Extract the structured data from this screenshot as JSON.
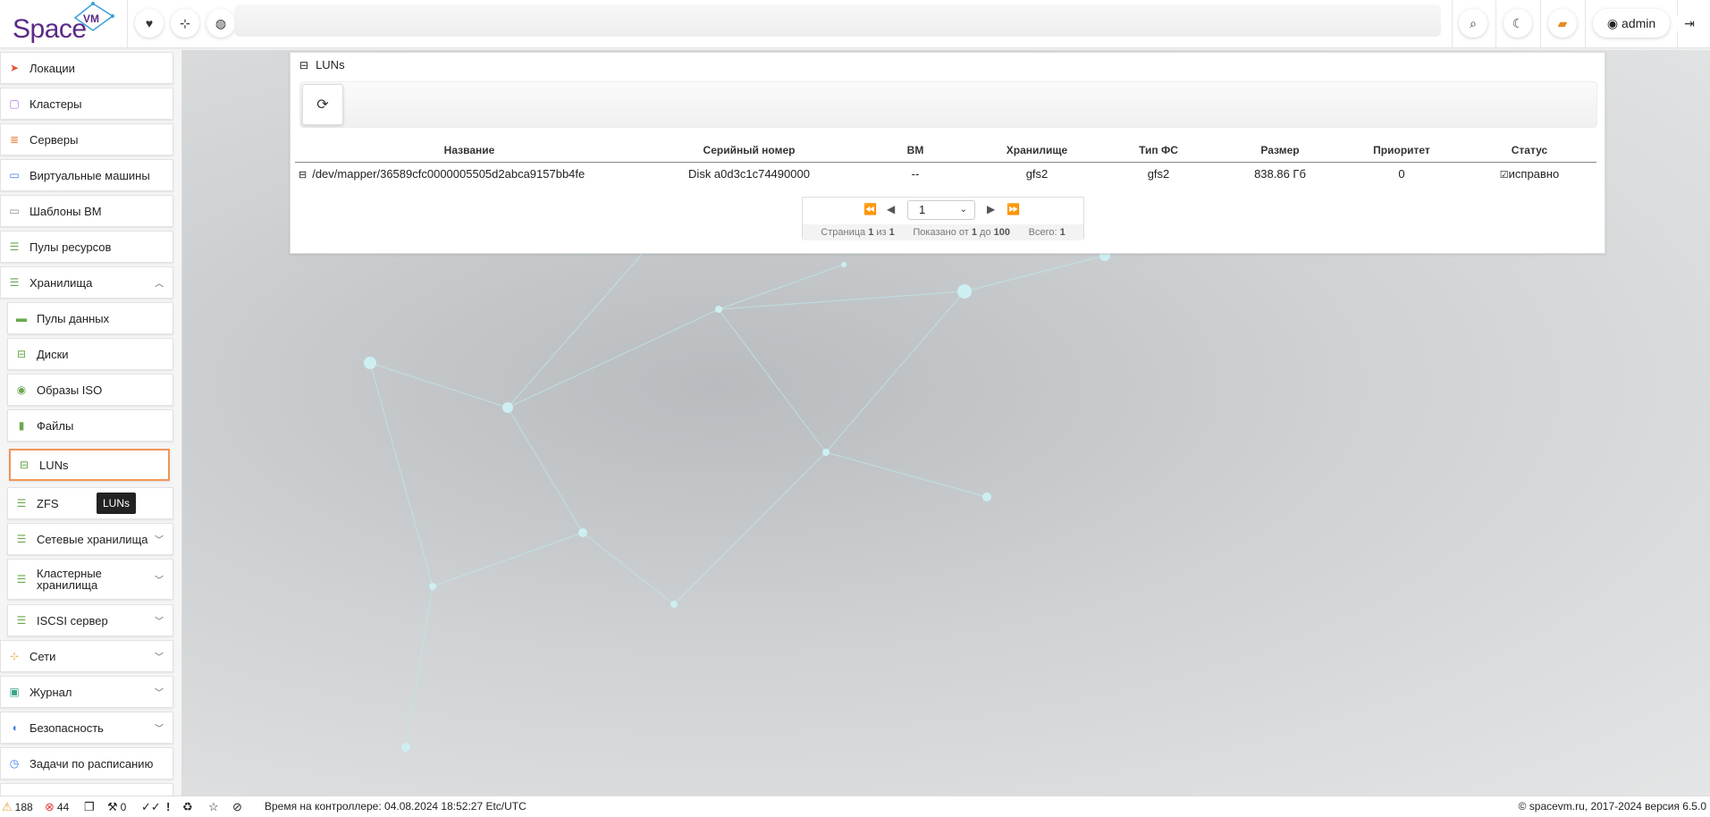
{
  "app": {
    "logo_text": "Space",
    "logo_sup": "VM",
    "user": "admin"
  },
  "top_icons": [
    "heartbeat-icon",
    "sitemap-icon",
    "globe-icon"
  ],
  "top_right_icons": [
    "search-icon",
    "moon-icon",
    "book-icon"
  ],
  "sidebar": {
    "items": [
      {
        "label": "Локации",
        "icon": "location-arrow-icon",
        "color": "#e5533d"
      },
      {
        "label": "Кластеры",
        "icon": "cluster-icon",
        "color": "#b678d9"
      },
      {
        "label": "Серверы",
        "icon": "server-icon",
        "color": "#e5823d"
      },
      {
        "label": "Виртуальные машины",
        "icon": "desktop-icon",
        "color": "#3d7be5"
      },
      {
        "label": "Шаблоны ВМ",
        "icon": "template-icon",
        "color": "#888888"
      },
      {
        "label": "Пулы ресурсов",
        "icon": "resource-pool-icon",
        "color": "#6aa84f"
      },
      {
        "label": "Хранилища",
        "icon": "database-icon",
        "color": "#6aa84f"
      }
    ],
    "storage_sub": [
      {
        "label": "Пулы данных",
        "icon": "folder-open-icon",
        "color": "#6aa84f"
      },
      {
        "label": "Диски",
        "icon": "hdd-icon",
        "color": "#6aa84f"
      },
      {
        "label": "Образы ISO",
        "icon": "disc-icon",
        "color": "#6aa84f"
      },
      {
        "label": "Файлы",
        "icon": "file-icon",
        "color": "#6aa84f"
      },
      {
        "label": "LUNs",
        "icon": "lun-icon",
        "color": "#6aa84f"
      },
      {
        "label": "ZFS",
        "icon": "zfs-icon",
        "color": "#6aa84f"
      },
      {
        "label": "Сетевые хранилища",
        "icon": "network-storage-icon",
        "color": "#6aa84f"
      },
      {
        "label": "Кластерные хранилища",
        "line1": "Кластерные",
        "line2": "хранилища",
        "icon": "cluster-storage-icon",
        "color": "#6aa84f"
      },
      {
        "label": "ISCSI сервер",
        "icon": "iscsi-icon",
        "color": "#6aa84f"
      }
    ],
    "bottom_items": [
      {
        "label": "Сети",
        "icon": "sitemap-icon",
        "color": "#e5a03d"
      },
      {
        "label": "Журнал",
        "icon": "journal-icon",
        "color": "#3da58a"
      },
      {
        "label": "Безопасность",
        "icon": "shield-icon",
        "color": "#3d7be5"
      },
      {
        "label": "Задачи по расписанию",
        "icon": "clock-icon",
        "color": "#3d7be5"
      }
    ],
    "tooltip": "LUNs"
  },
  "panel": {
    "title": "LUNs",
    "columns": [
      "Название",
      "Серийный номер",
      "ВМ",
      "Хранилище",
      "Тип ФС",
      "Размер",
      "Приоритет",
      "Статус"
    ],
    "rows": [
      {
        "name": "/dev/mapper/36589cfc0000005505d2abca9157bb4fe",
        "serial": "Disk a0d3c1c74490000",
        "vm": "--",
        "storage": "gfs2",
        "fs_type": "gfs2",
        "size": "838.86 Гб",
        "priority": "0",
        "status": "исправно"
      }
    ]
  },
  "pager": {
    "current_page": "1",
    "page_label": "Страница",
    "page_of": "из",
    "page_num": "1",
    "total_pages": "1",
    "shown_label": "Показано от",
    "shown_from": "1",
    "shown_to_label": "до",
    "shown_to": "100",
    "total_label": "Всего:",
    "total": "1"
  },
  "statusbar": {
    "warnings": "188",
    "errors": "44",
    "tasks": "0",
    "controller_time": "Время на контроллере: 04.08.2024 18:52:27 Etc/UTC",
    "copyright": "© spacevm.ru, 2017-2024 версия 6.5.0"
  }
}
